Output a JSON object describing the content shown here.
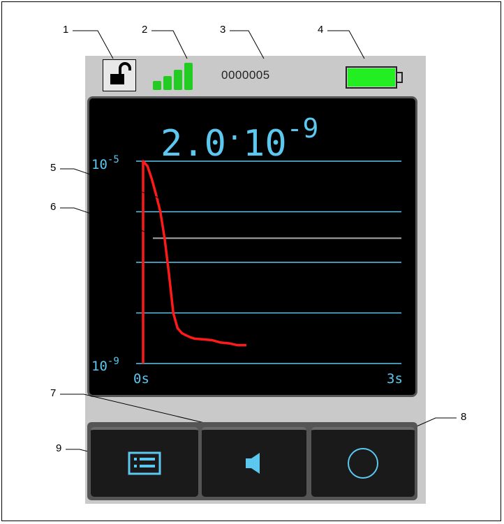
{
  "callouts": [
    "1",
    "2",
    "3",
    "4",
    "5",
    "6",
    "7",
    "8",
    "9"
  ],
  "status": {
    "counter": "0000005",
    "lock_icon": "unlocked-padlock-icon",
    "signal_icon": "signal-strength-icon",
    "battery_icon": "battery-full-icon",
    "signal_color": "#22cc22",
    "battery_color": "#22ee22"
  },
  "reading": {
    "mantissa": "2.0",
    "dot": "·",
    "base": "10",
    "exponent": "-9"
  },
  "chart_data": {
    "type": "line",
    "y_scale": "log",
    "y_ticks": [
      "10",
      "10"
    ],
    "y_top_label": {
      "base": "10",
      "exp": "-5"
    },
    "y_bottom_label": {
      "base": "10",
      "exp": "-9"
    },
    "ylim": [
      1e-09,
      1e-05
    ],
    "x_start_label": "0s",
    "x_end_label": "3s",
    "xlim": [
      0,
      3
    ],
    "threshold": 3e-07,
    "series_color": "#ff1a1a",
    "threshold_color": "#aaaaaa",
    "grid_color": "#5cc8f0",
    "x": [
      0.0,
      0.05,
      0.1,
      0.15,
      0.2,
      0.25,
      0.3,
      0.35,
      0.4,
      0.45,
      0.5,
      0.55,
      0.6,
      0.7,
      0.8,
      0.9,
      1.0,
      1.1,
      1.2
    ],
    "y": [
      1e-05,
      8e-06,
      4.5e-06,
      2.2e-06,
      1e-06,
      3e-07,
      6e-08,
      1e-08,
      5e-09,
      4e-09,
      3.6e-09,
      3.3e-09,
      3.1e-09,
      3e-09,
      2.9e-09,
      2.6e-09,
      2.5e-09,
      2.3e-09,
      2.3e-09
    ]
  },
  "buttons": [
    {
      "icon": "menu-list-icon"
    },
    {
      "icon": "speaker-icon"
    },
    {
      "icon": "circle-record-icon"
    }
  ]
}
